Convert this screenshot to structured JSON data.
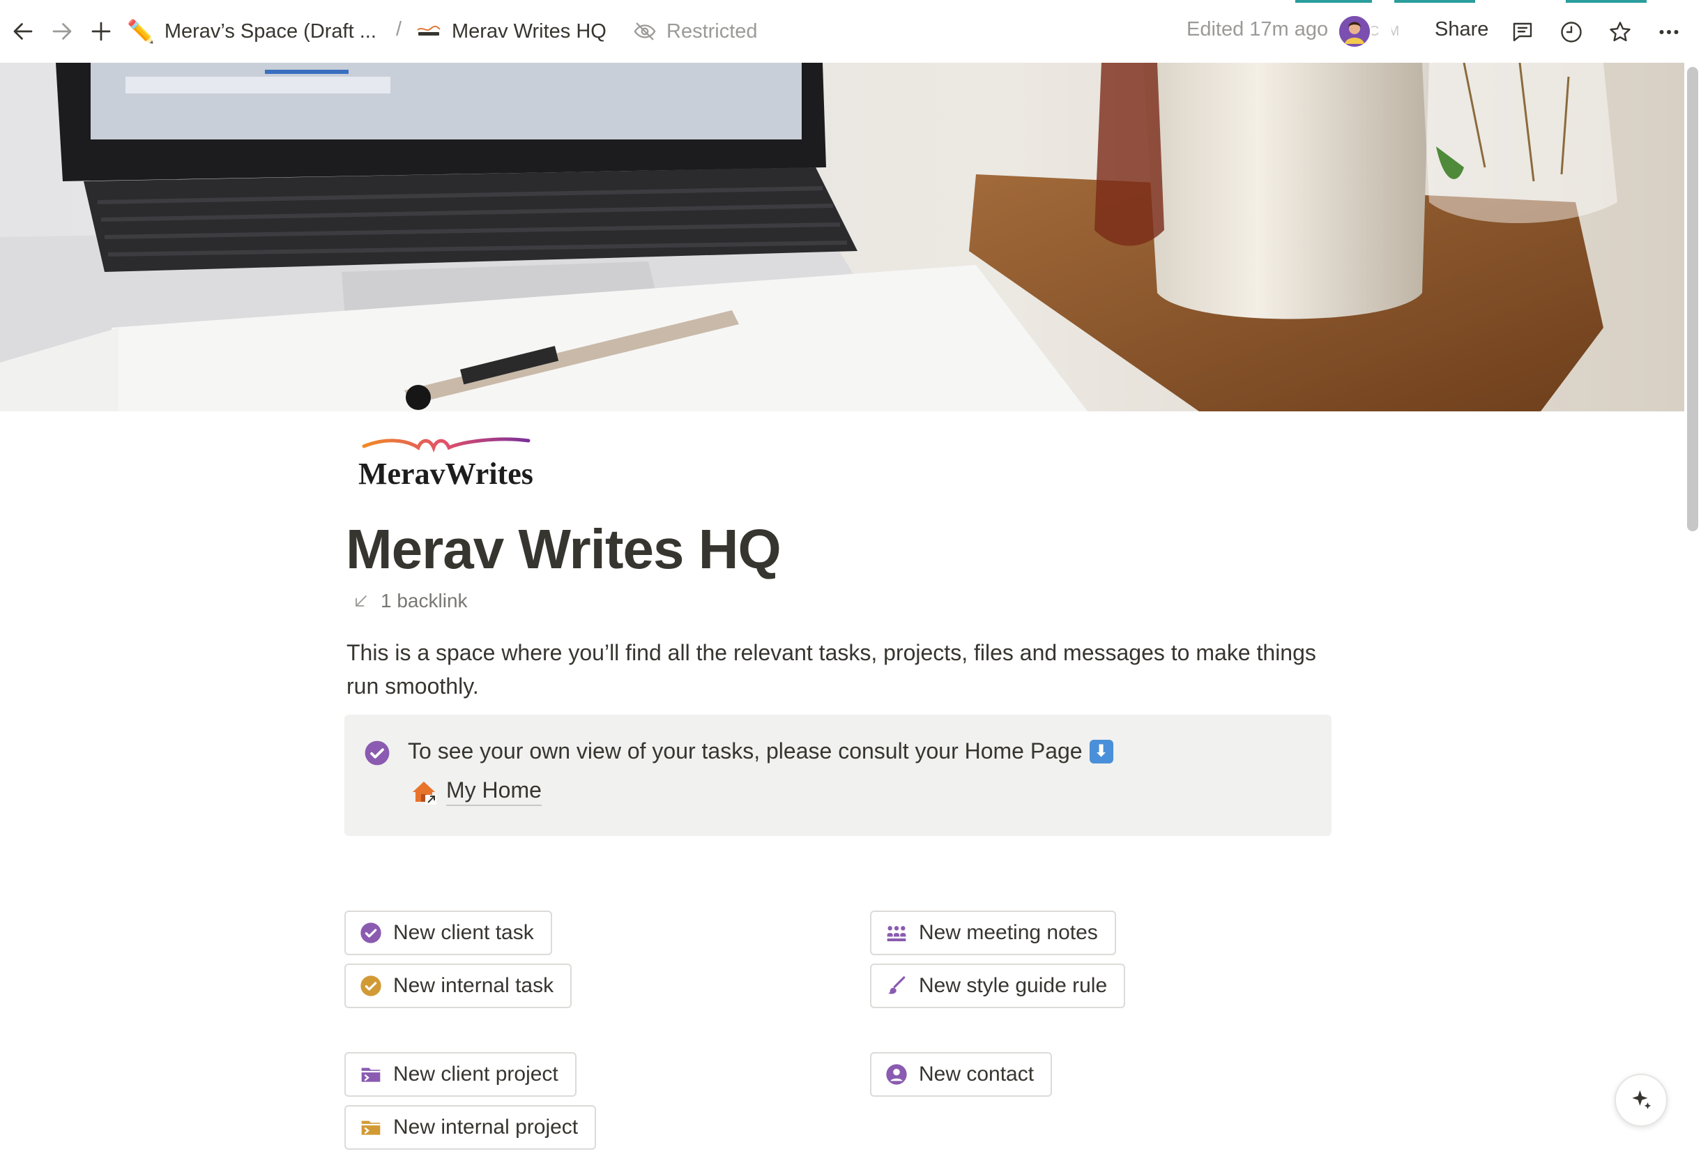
{
  "topbar": {
    "breadcrumb_parent": "Merav’s Space (Draft ...",
    "breadcrumb_parent_icon": "pencil-emoji",
    "breadcrumb_separator": "/",
    "breadcrumb_current": "Merav Writes HQ",
    "restricted_label": "Restricted",
    "edited_label": "Edited 17m ago",
    "avatar_initials": [
      "C",
      "M"
    ],
    "share_label": "Share",
    "accent_color": "#2a9d9d"
  },
  "page": {
    "logo_text": "MeravWrites",
    "logo_script": "mw",
    "title": "Merav Writes HQ",
    "backlinks": "1 backlink",
    "intro": "This is a space where you’ll find all the relevant tasks, projects, files and messages to make things run smoothly.",
    "callout": {
      "text": "To see your own view of your tasks, please consult your Home Page",
      "arrow_icon": "down-arrow-emoji",
      "link_label": "My Home",
      "icon": "check-circle-icon",
      "background": "#f1f1ef"
    }
  },
  "buttons": {
    "client_task": "New client task",
    "internal_task": "New internal task",
    "client_project": "New client project",
    "internal_project": "New internal project",
    "meeting_notes": "New meeting notes",
    "style_guide_rule": "New style guide rule",
    "contact": "New contact"
  },
  "colors": {
    "purple": "#8a5bb0",
    "gold": "#d19a35",
    "text": "#37352f",
    "muted": "#9b9a97"
  }
}
